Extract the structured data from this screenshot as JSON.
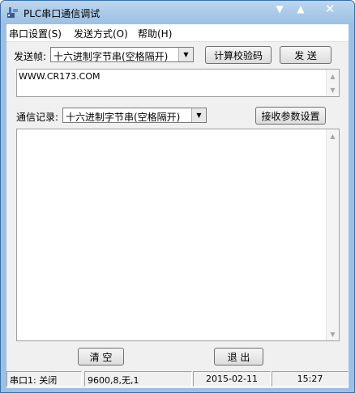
{
  "window": {
    "title": "PLC串口通信调试"
  },
  "menu": {
    "items": [
      "串口设置(S)",
      "发送方式(O)",
      "帮助(H)"
    ]
  },
  "send": {
    "label": "发送帧:",
    "format": "十六进制字节串(空格隔开)",
    "checksum_button": "计算校验码",
    "send_button": "发 送",
    "content": "WWW.CR173.COM"
  },
  "receive": {
    "label": "通信记录:",
    "format": "十六进制字节串(空格隔开)",
    "params_button": "接收参数设置",
    "content": ""
  },
  "actions": {
    "clear_button": "清 空",
    "exit_button": "退 出"
  },
  "status": {
    "port": "串口1: 关闭",
    "settings": "9600,8,无,1",
    "date": "2015-02-11",
    "time": "15:27"
  },
  "colors": {
    "titlebar": "#9cc0e4",
    "client": "#f0f0f0"
  }
}
